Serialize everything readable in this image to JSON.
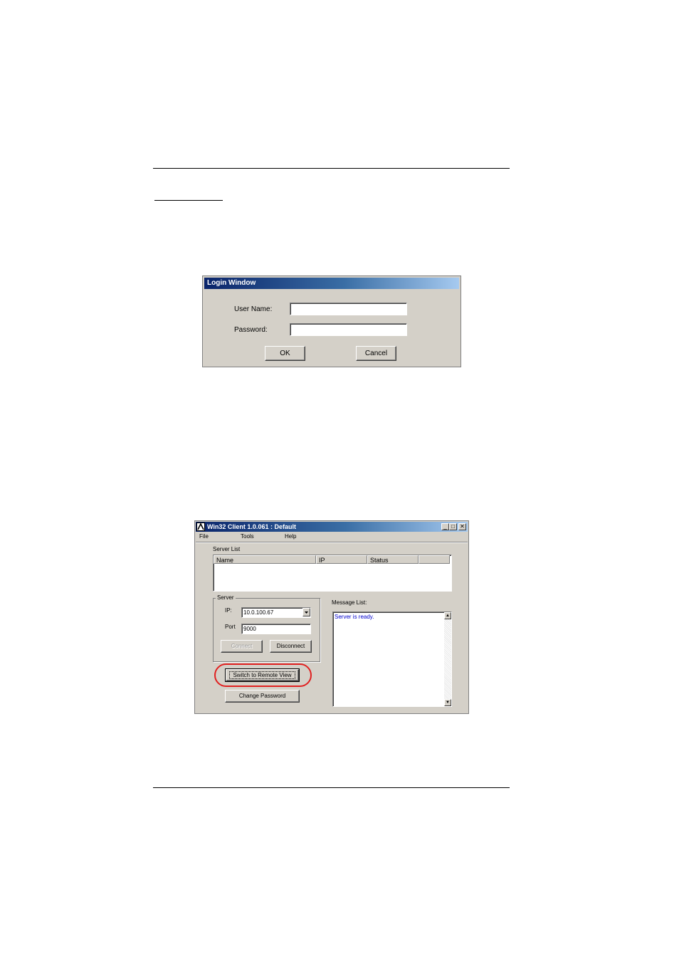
{
  "login_window": {
    "title": "Login Window",
    "username_label": "User Name:",
    "username_value": "",
    "password_label": "Password:",
    "password_value": "",
    "ok_label": "OK",
    "cancel_label": "Cancel"
  },
  "client_window": {
    "title": "Win32 Client 1.0.061 : Default",
    "title_controls": {
      "minimize": "_",
      "maximize": "□",
      "close": "✕"
    },
    "menu": [
      "File",
      "Tools",
      "Help"
    ],
    "server_list": {
      "label": "Server List",
      "columns": [
        "Name",
        "IP",
        "Status"
      ],
      "rows": []
    },
    "server_group": {
      "legend": "Server",
      "ip_label": "IP:",
      "ip_value": "10.0.100.67",
      "port_label": "Port",
      "port_value": "9000",
      "connect_label": "Connect",
      "disconnect_label": "Disconnect"
    },
    "switch_button_label": "Switch to Remote View",
    "change_password_label": "Change Password",
    "message_list": {
      "label": "Message List:",
      "messages": [
        "Server is ready."
      ]
    },
    "highlight_color": "#e02020"
  }
}
